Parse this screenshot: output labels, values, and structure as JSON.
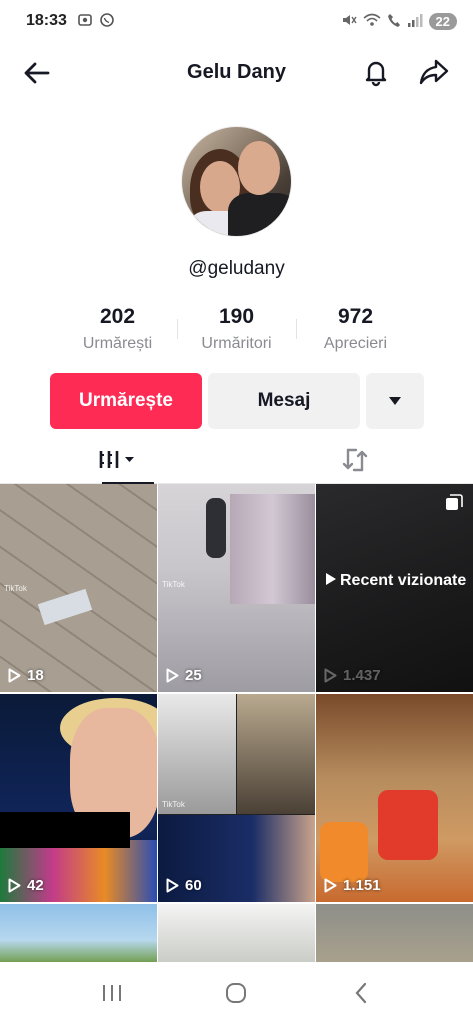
{
  "status": {
    "time": "18:33",
    "battery": "22"
  },
  "header": {
    "title": "Gelu Dany"
  },
  "profile": {
    "username": "@geludany",
    "stats": [
      {
        "value": "202",
        "label": "Urmărești"
      },
      {
        "value": "190",
        "label": "Urmăritori"
      },
      {
        "value": "972",
        "label": "Aprecieri"
      }
    ]
  },
  "actions": {
    "follow_label": "Urmărește",
    "message_label": "Mesaj"
  },
  "videos": [
    {
      "views": "18"
    },
    {
      "views": "25"
    },
    {
      "views": "1.437",
      "overlay": "Recent vizionate"
    },
    {
      "views": "42"
    },
    {
      "views": "60"
    },
    {
      "views": "1.151"
    }
  ],
  "watermarks": {
    "tiktok": "TikTok"
  }
}
